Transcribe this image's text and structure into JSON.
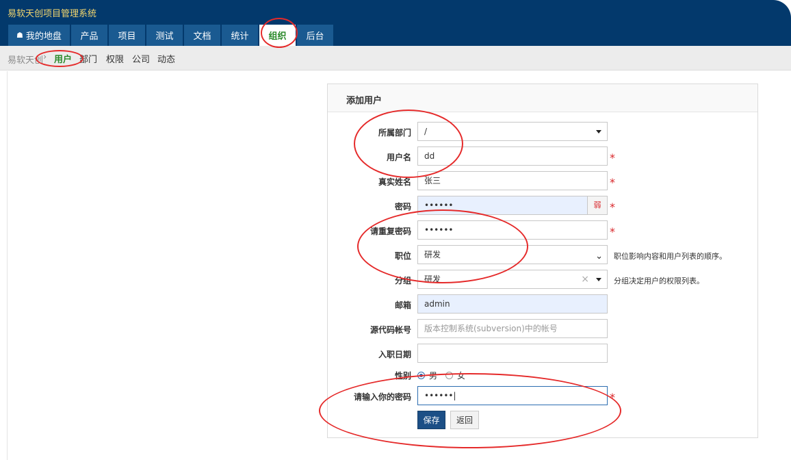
{
  "app": {
    "title": "易软天创项目管理系统"
  },
  "main_nav": {
    "tabs": [
      {
        "label": "我的地盘",
        "icon": "home-icon"
      },
      {
        "label": "产品"
      },
      {
        "label": "项目"
      },
      {
        "label": "测试"
      },
      {
        "label": "文档"
      },
      {
        "label": "统计"
      },
      {
        "label": "组织",
        "active": true
      },
      {
        "label": "后台"
      }
    ]
  },
  "subnav": {
    "breadcrumb": "易软天创",
    "separator": "›",
    "items": [
      {
        "label": "用户",
        "active": true
      },
      {
        "label": "部门"
      },
      {
        "label": "权限"
      },
      {
        "label": "公司"
      },
      {
        "label": "动态"
      }
    ]
  },
  "form": {
    "title": "添加用户",
    "dept": {
      "label": "所属部门",
      "value": "/"
    },
    "account": {
      "label": "用户名",
      "value": "dd",
      "required": "*"
    },
    "realname": {
      "label": "真实姓名",
      "value": "张三",
      "required": "*"
    },
    "password": {
      "label": "密码",
      "value": "••••••",
      "required": "*",
      "strength_icon": "弱"
    },
    "password2": {
      "label": "请重复密码",
      "value": "••••••",
      "required": "*"
    },
    "role": {
      "label": "职位",
      "value": "研发",
      "hint": "职位影响内容和用户列表的顺序。"
    },
    "group": {
      "label": "分组",
      "value": "研发",
      "clear": "×",
      "hint": "分组决定用户的权限列表。"
    },
    "email": {
      "label": "邮箱",
      "value": "admin"
    },
    "commiter": {
      "label": "源代码帐号",
      "placeholder": "版本控制系统(subversion)中的帐号"
    },
    "join": {
      "label": "入职日期",
      "value": ""
    },
    "gender": {
      "label": "性别",
      "options": [
        "男",
        "女"
      ],
      "selected": "男"
    },
    "verify": {
      "label": "请输入你的密码",
      "value": "••••••|",
      "required": "*"
    },
    "save_label": "保存",
    "back_label": "返回"
  },
  "colors": {
    "header_bg": "#03396c",
    "title_text": "#f5d76e",
    "tab_bg": "#1a5a91",
    "active_tab_text": "#2b8a2b",
    "required": "#d9262a",
    "save_button": "#1c4f86",
    "annotation": "#e52a2a"
  }
}
